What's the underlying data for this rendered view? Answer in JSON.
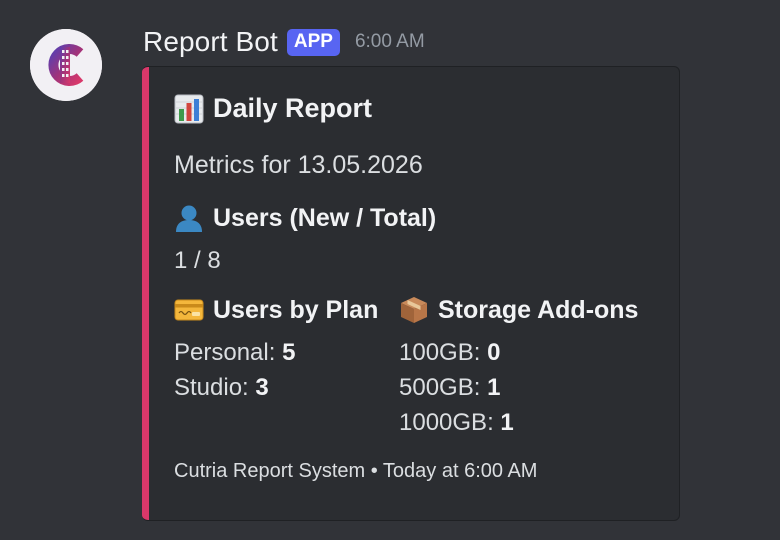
{
  "message": {
    "username": "Report Bot",
    "badge": "APP",
    "timestamp": "6:00 AM",
    "avatar_icon": "film-strip-c-logo-icon"
  },
  "embed": {
    "accent_color": "#d9386a",
    "title_icon": "bar-chart-emoji-icon",
    "title": "Daily Report",
    "description": "Metrics for 13.05.2026",
    "users_field": {
      "icon": "bust-in-silhouette-emoji-icon",
      "title": "Users (New / Total)",
      "value": "1 / 8"
    },
    "plan_field": {
      "icon": "credit-card-emoji-icon",
      "title": "Users by Plan",
      "rows": [
        {
          "label": "Personal:",
          "value": "5"
        },
        {
          "label": "Studio:",
          "value": "3"
        }
      ]
    },
    "storage_field": {
      "icon": "package-emoji-icon",
      "title": "Storage Add-ons",
      "rows": [
        {
          "label": "100GB:",
          "value": "0"
        },
        {
          "label": "500GB:",
          "value": "1"
        },
        {
          "label": "1000GB:",
          "value": "1"
        }
      ]
    },
    "footer": "Cutria Report System • Today at 6:00 AM"
  }
}
